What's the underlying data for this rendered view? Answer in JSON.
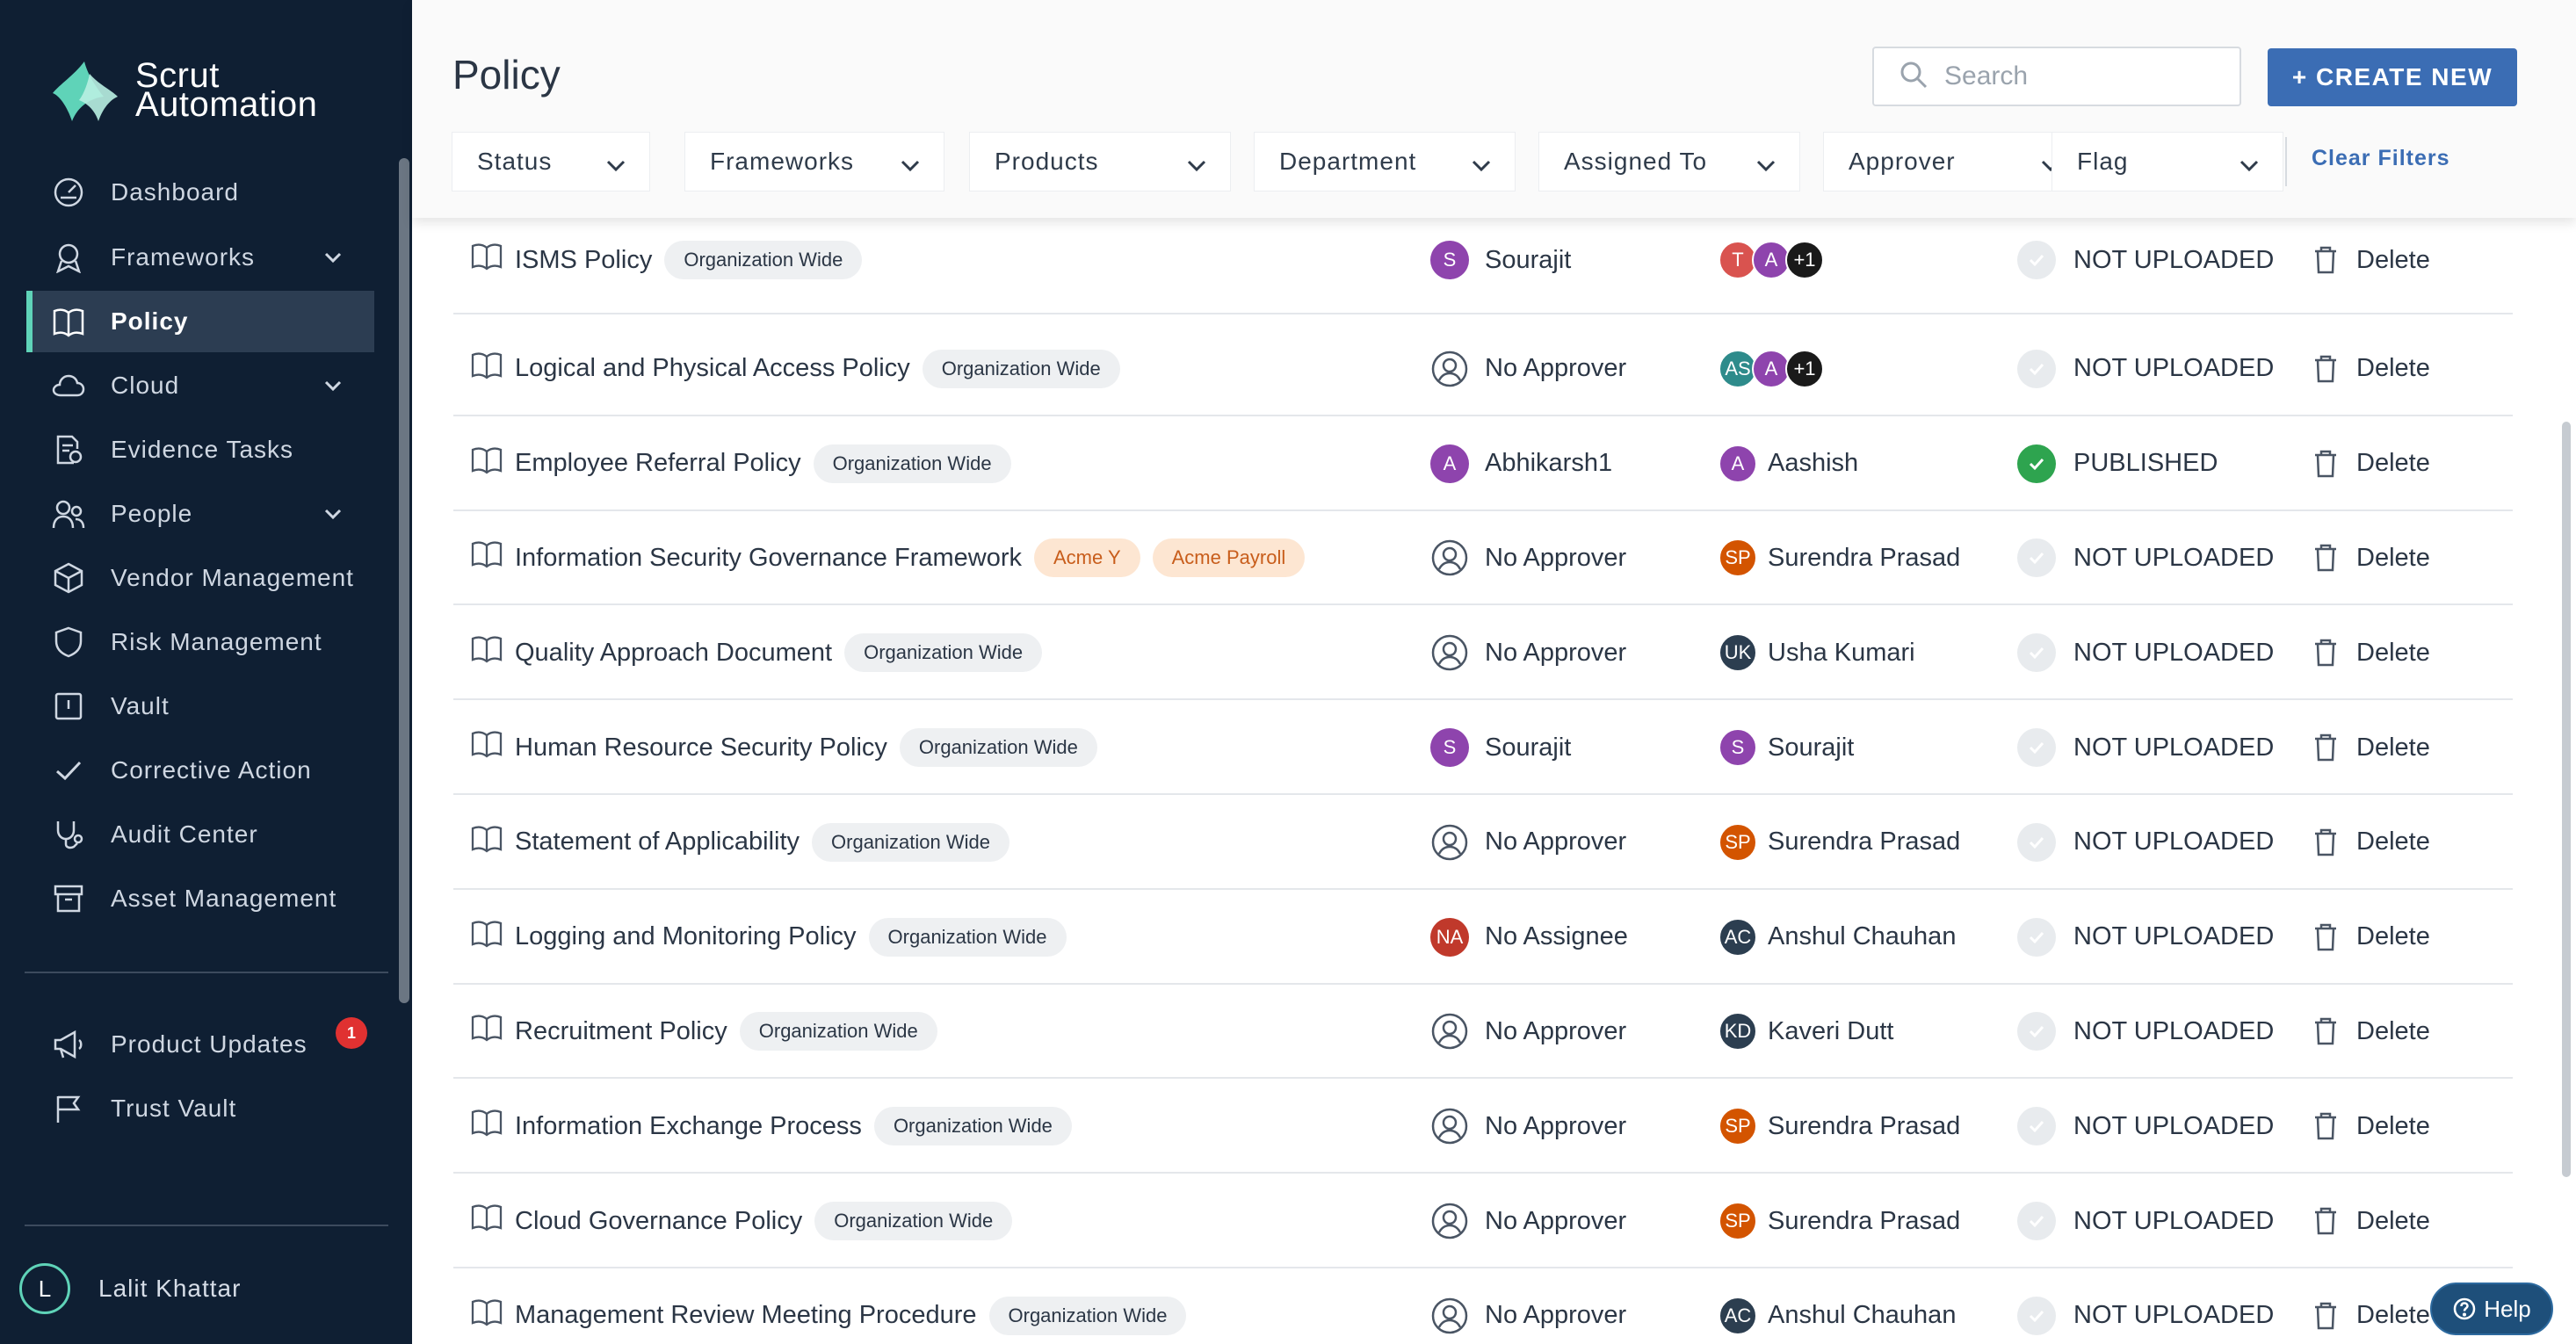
{
  "app": {
    "logo_line1": "Scrut",
    "logo_line2": "Automation",
    "brand_color": "#5fd3b8"
  },
  "sidebar": {
    "items": [
      {
        "label": "Dashboard",
        "icon": "dashboard-icon"
      },
      {
        "label": "Frameworks",
        "icon": "frameworks-icon",
        "expandable": true
      },
      {
        "label": "Policy",
        "icon": "book-icon",
        "active": true
      },
      {
        "label": "Cloud",
        "icon": "cloud-icon",
        "expandable": true
      },
      {
        "label": "Evidence Tasks",
        "icon": "evidence-icon"
      },
      {
        "label": "People",
        "icon": "people-icon",
        "expandable": true
      },
      {
        "label": "Vendor Management",
        "icon": "box-icon"
      },
      {
        "label": "Risk Management",
        "icon": "shield-icon"
      },
      {
        "label": "Vault",
        "icon": "vault-icon"
      },
      {
        "label": "Corrective Action",
        "icon": "check-icon"
      },
      {
        "label": "Audit Center",
        "icon": "stethoscope-icon"
      },
      {
        "label": "Asset Management",
        "icon": "archive-icon"
      }
    ],
    "bottom_items": [
      {
        "label": "Product Updates",
        "icon": "megaphone-icon",
        "badge": "1"
      },
      {
        "label": "Trust Vault",
        "icon": "flag-icon"
      }
    ],
    "user": {
      "initial": "L",
      "name": "Lalit Khattar"
    }
  },
  "header": {
    "title": "Policy",
    "search_placeholder": "Search",
    "create_label": "+ CREATE NEW",
    "filters": [
      "Status",
      "Frameworks",
      "Products",
      "Department",
      "Assigned To",
      "Approver",
      "Flag"
    ],
    "clear_label": "Clear Filters"
  },
  "rows": [
    {
      "name": "ISMS Policy",
      "tags": [
        "Organization Wide"
      ],
      "approver": "Sourajit",
      "approver_av": "S",
      "assignees": [
        "T",
        "A",
        "+1"
      ],
      "assigned": "",
      "status": "NOT UPLOADED",
      "delete": "Delete"
    },
    {
      "name": "Logical and Physical Access Policy",
      "tags": [
        "Organization Wide"
      ],
      "approver": "No Approver",
      "approver_av": "",
      "assignees": [
        "AS",
        "A",
        "+1"
      ],
      "assigned": "",
      "status": "NOT UPLOADED",
      "delete": "Delete"
    },
    {
      "name": "Employee Referral Policy",
      "tags": [
        "Organization Wide"
      ],
      "approver": "Abhikarsh1",
      "approver_av": "A",
      "assignees": [
        "A"
      ],
      "assigned": "Aashish",
      "status": "PUBLISHED",
      "delete": "Delete"
    },
    {
      "name": "Information Security Governance Framework",
      "tags": [
        "Acme Y",
        "Acme Payroll"
      ],
      "approver": "No Approver",
      "approver_av": "",
      "assignees": [
        "SP"
      ],
      "assigned": "Surendra Prasad",
      "status": "NOT UPLOADED",
      "delete": "Delete"
    },
    {
      "name": "Quality Approach Document",
      "tags": [
        "Organization Wide"
      ],
      "approver": "No Approver",
      "approver_av": "",
      "assignees": [
        "UK"
      ],
      "assigned": "Usha Kumari",
      "status": "NOT UPLOADED",
      "delete": "Delete"
    },
    {
      "name": "Human Resource Security Policy",
      "tags": [
        "Organization Wide"
      ],
      "approver": "Sourajit",
      "approver_av": "S",
      "assignees": [
        "S"
      ],
      "assigned": "Sourajit",
      "status": "NOT UPLOADED",
      "delete": "Delete"
    },
    {
      "name": "Statement of Applicability",
      "tags": [
        "Organization Wide"
      ],
      "approver": "No Approver",
      "approver_av": "",
      "assignees": [
        "SP"
      ],
      "assigned": "Surendra Prasad",
      "status": "NOT UPLOADED",
      "delete": "Delete"
    },
    {
      "name": "Logging and Monitoring Policy",
      "tags": [
        "Organization Wide"
      ],
      "approver": "No Assignee",
      "approver_av": "NA",
      "assignees": [
        "AC"
      ],
      "assigned": "Anshul Chauhan",
      "status": "NOT UPLOADED",
      "delete": "Delete"
    },
    {
      "name": "Recruitment Policy",
      "tags": [
        "Organization Wide"
      ],
      "approver": "No Approver",
      "approver_av": "",
      "assignees": [
        "KD"
      ],
      "assigned": "Kaveri Dutt",
      "status": "NOT UPLOADED",
      "delete": "Delete"
    },
    {
      "name": "Information Exchange Process",
      "tags": [
        "Organization Wide"
      ],
      "approver": "No Approver",
      "approver_av": "",
      "assignees": [
        "SP"
      ],
      "assigned": "Surendra Prasad",
      "status": "NOT UPLOADED",
      "delete": "Delete"
    },
    {
      "name": "Cloud Governance Policy",
      "tags": [
        "Organization Wide"
      ],
      "approver": "No Approver",
      "approver_av": "",
      "assignees": [
        "SP"
      ],
      "assigned": "Surendra Prasad",
      "status": "NOT UPLOADED",
      "delete": "Delete"
    },
    {
      "name": "Management Review Meeting Procedure",
      "tags": [
        "Organization Wide"
      ],
      "approver": "No Approver",
      "approver_av": "",
      "assignees": [
        "AC"
      ],
      "assigned": "Anshul Chauhan",
      "status": "NOT UPLOADED",
      "delete": "Delete"
    }
  ],
  "help_label": "Help",
  "avatar_colors": {
    "S": "#8e44ad",
    "A": "#8e44ad",
    "T": "#d9534f",
    "SP": "#d35400",
    "UK": "#2c3e50",
    "AC": "#2c3e50",
    "KD": "#2c3e50",
    "NA": "#c0392b",
    "AS": "#2e8b8b",
    "+1": "#1a1a1a"
  }
}
